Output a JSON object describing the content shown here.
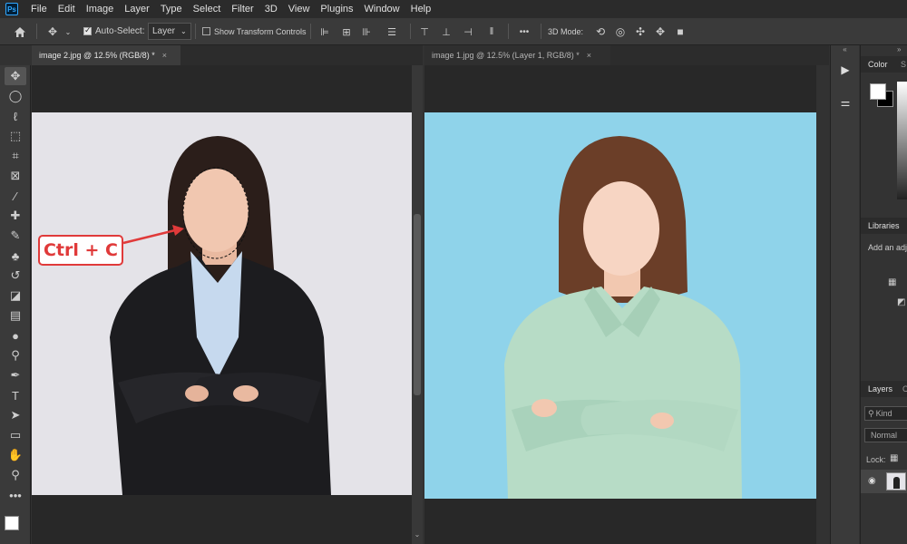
{
  "app": {
    "logo_text": "Ps"
  },
  "menu": [
    "File",
    "Edit",
    "Image",
    "Layer",
    "Type",
    "Select",
    "Filter",
    "3D",
    "View",
    "Plugins",
    "Window",
    "Help"
  ],
  "options_bar": {
    "auto_select_label": "Auto-Select:",
    "auto_select_checked": true,
    "auto_select_target": "Layer",
    "show_transform_label": "Show Transform Controls",
    "more_label": "•••",
    "mode_3d_label": "3D Mode:"
  },
  "tabs": [
    {
      "title": "image 2.jpg @ 12.5% (RGB/8) *",
      "active": true
    },
    {
      "title": "image 1.jpg @ 12.5% (Layer 1, RGB/8) *",
      "active": false
    }
  ],
  "annotation": {
    "shortcut_text": "Ctrl + C",
    "color": "#e03a3a"
  },
  "panels": {
    "color_tab": "Color",
    "swatches_tab_stub": "S",
    "libraries_tab": "Libraries",
    "adjust_text_stub": "Add an adju",
    "layers_tab": "Layers",
    "layers_next_tab_stub": "C",
    "kind_placeholder": "Kind",
    "blend_mode": "Normal",
    "lock_label": "Lock:"
  },
  "colors": {
    "accent": "#31a8ff",
    "doc1_background": "#e4e3e8",
    "doc2_background": "#8fd3ea"
  }
}
